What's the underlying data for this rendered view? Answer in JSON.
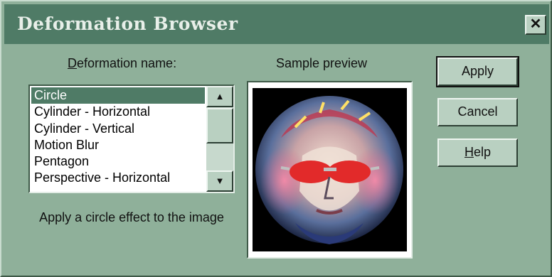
{
  "window": {
    "title": "Deformation Browser",
    "close_glyph": "✕"
  },
  "labels": {
    "deformation_name_mnemonic": "D",
    "deformation_name_rest": "eformation name:",
    "sample_preview": "Sample preview"
  },
  "list": {
    "items": [
      {
        "label": "Circle",
        "selected": true
      },
      {
        "label": "Cylinder - Horizontal",
        "selected": false
      },
      {
        "label": "Cylinder - Vertical",
        "selected": false
      },
      {
        "label": "Motion Blur",
        "selected": false
      },
      {
        "label": "Pentagon",
        "selected": false
      },
      {
        "label": "Perspective - Horizontal",
        "selected": false
      }
    ],
    "scroll_up_glyph": "▲",
    "scroll_down_glyph": "▼"
  },
  "description": "Apply a circle effect to the image",
  "buttons": {
    "apply": "Apply",
    "cancel": "Cancel",
    "help_mnemonic": "H",
    "help_rest": "elp"
  },
  "icons": {
    "close": "close-icon",
    "scroll_up": "arrow-up-icon",
    "scroll_down": "arrow-down-icon"
  },
  "colors": {
    "dialog_bg": "#8fb09a",
    "titlebar_bg": "#4f7b66",
    "selection_bg": "#4f7b66"
  }
}
